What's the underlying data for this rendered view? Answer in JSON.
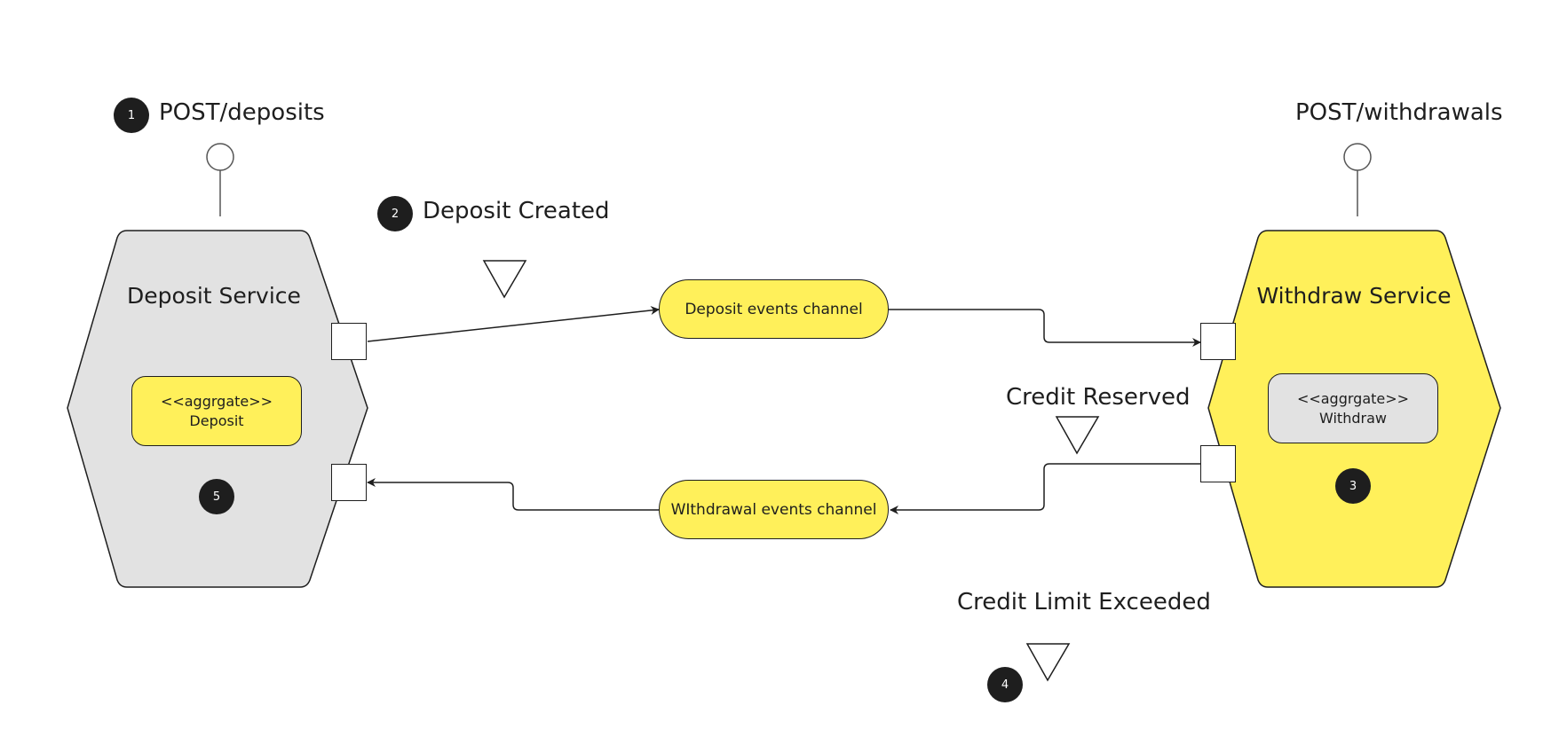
{
  "colors": {
    "yellow": "#fff05a",
    "gray": "#e2e2e2",
    "ink": "#1e1e1e",
    "step_badge": "#1e1e1e"
  },
  "endpoints": {
    "deposits": {
      "label": "POST/deposits",
      "step": "1"
    },
    "withdrawals": {
      "label": "POST/withdrawals"
    }
  },
  "services": {
    "deposit": {
      "title": "Deposit Service",
      "aggregate_stereotype": "<<aggrgate>>",
      "aggregate_name": "Deposit",
      "step": "5"
    },
    "withdraw": {
      "title": "Withdraw Service",
      "aggregate_stereotype": "<<aggrgate>>",
      "aggregate_name": "Withdraw",
      "step": "3"
    }
  },
  "channels": {
    "deposit_events": "Deposit events channel",
    "withdrawal_events": "WIthdrawal events channel"
  },
  "events": {
    "deposit_created": {
      "label": "Deposit Created",
      "step": "2"
    },
    "credit_reserved": {
      "label": "Credit Reserved"
    },
    "credit_limit_exceeded": {
      "label": "Credit Limit Exceeded",
      "step": "4"
    }
  }
}
